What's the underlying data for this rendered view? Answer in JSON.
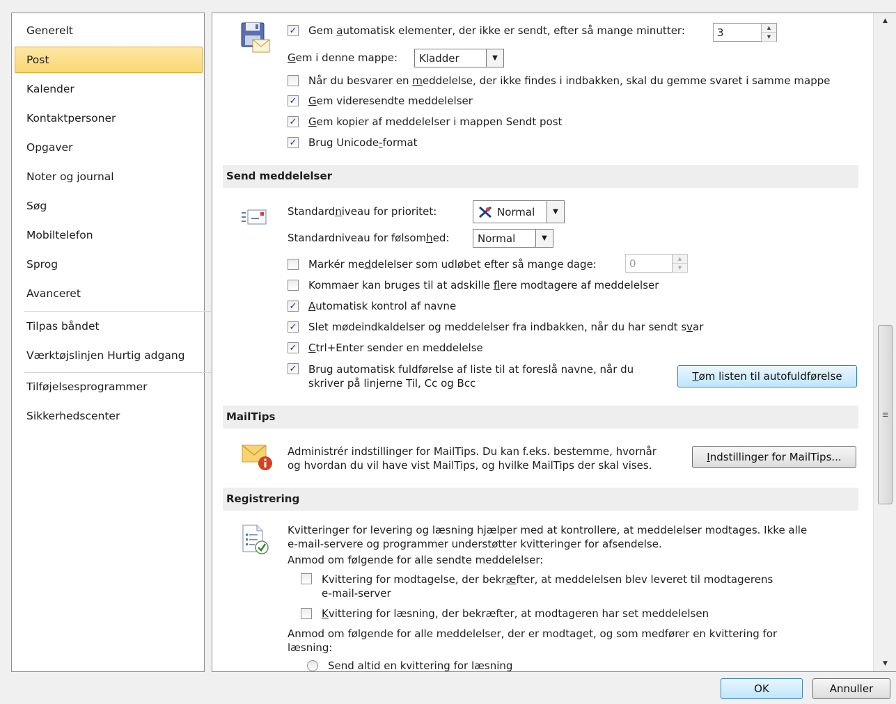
{
  "sidebar": {
    "items": [
      {
        "label": "Generelt"
      },
      {
        "label": "Post"
      },
      {
        "label": "Kalender"
      },
      {
        "label": "Kontaktpersoner"
      },
      {
        "label": "Opgaver"
      },
      {
        "label": "Noter og journal"
      },
      {
        "label": "Søg"
      },
      {
        "label": "Mobiltelefon"
      },
      {
        "label": "Sprog"
      },
      {
        "label": "Avanceret"
      },
      {
        "label": "Tilpas båndet"
      },
      {
        "label": "Værktøjslinjen Hurtig adgang"
      },
      {
        "label": "Tilføjelsesprogrammer"
      },
      {
        "label": "Sikkerhedscenter"
      }
    ],
    "selected": "Post"
  },
  "save": {
    "autosave": {
      "pre": "Gem ",
      "ul": "a",
      "post": "utomatisk elementer, der ikke er sendt, efter så mange minutter:",
      "checked": true
    },
    "minutes_value": "3",
    "folder_label": {
      "pre": "",
      "ul": "G",
      "post": "em i denne mappe:"
    },
    "folder_value": "Kladder",
    "reply_same_folder": {
      "pre": "Når du besvarer en ",
      "ul": "m",
      "post": "eddelelse, der ikke findes i indbakken, skal du gemme svaret i samme mappe",
      "checked": false
    },
    "save_forwarded": {
      "pre": "",
      "ul": "G",
      "post": "em videresendte meddelelser",
      "checked": true
    },
    "save_copies": {
      "pre": "",
      "ul": "G",
      "post": "em kopier af meddelelser i mappen Sendt post",
      "checked": true
    },
    "unicode": {
      "pre": "Brug Unicode",
      "ul": "-",
      "post": "format",
      "checked": true
    }
  },
  "send": {
    "header": "Send meddelelser",
    "priority_label": {
      "pre": "Standard",
      "ul": "n",
      "post": "iveau for prioritet:"
    },
    "priority_value": "Normal",
    "sensitivity_label": {
      "pre": "Standardniveau for følsom",
      "ul": "h",
      "post": "ed:"
    },
    "sensitivity_value": "Normal",
    "expire": {
      "pre": "Markér me",
      "ul": "d",
      "post": "delelser som udløbet efter så mange dage:",
      "checked": false
    },
    "expire_days": "0",
    "commas": {
      "pre": "Kommaer kan bruges til at adskille ",
      "ul": "f",
      "post": "lere modtagere af meddelelser",
      "checked": false
    },
    "auto_check_names": {
      "pre": "",
      "ul": "A",
      "post": "utomatisk kontrol af navne",
      "checked": true
    },
    "delete_meeting": {
      "pre": "Slet mødeindkaldelser og meddelelser fra indbakken, når du har sendt s",
      "ul": "v",
      "post": "ar",
      "checked": true
    },
    "ctrl_enter": {
      "pre": "",
      "ul": "C",
      "post": "trl+Enter sender en meddelelse",
      "checked": true
    },
    "autocomplete": {
      "line1": "Brug automatisk fuldførelse af liste til at foreslå navne, når du",
      "line2_pre": "skriver på lin",
      "line2_ul": "j",
      "line2_post": "erne Til, Cc og Bcc",
      "checked": true
    },
    "empty_autocomplete": {
      "pre": "",
      "ul": "T",
      "post": "øm listen til autofuldførelse"
    }
  },
  "mailtips": {
    "header": "MailTips",
    "desc_line1": "Administrér indstillinger for MailTips. Du kan f.eks. bestemme, hvornår",
    "desc_line2": "og hvordan du vil have vist MailTips, og hvilke MailTips der skal vises.",
    "button": {
      "pre": "",
      "ul": "I",
      "post": "ndstillinger for MailTips..."
    }
  },
  "tracking": {
    "header": "Registrering",
    "desc_line1": "Kvitteringer for levering og læsning hjælper med at kontrollere, at meddelelser modtages. Ikke alle",
    "desc_line2": "e-mail-servere og programmer understøtter kvitteringer for afsendelse.",
    "request_label": "Anmod om følgende for alle sendte meddelelser:",
    "delivery": {
      "pre": "Kvittering for modtagelse, der bekr",
      "ul": "æ",
      "post": "fter, at meddelelsen blev leveret til modtagerens",
      "line2": "e-mail-server",
      "checked": false
    },
    "read": {
      "pre": "",
      "ul": "K",
      "post": "vittering for læsning, der bekræfter, at modtageren har set meddelelsen",
      "checked": false
    },
    "received_line1": "Anmod om følgende for alle meddelelser, der er modtaget, og som medfører en kvittering for",
    "received_line2": "læsning:",
    "always_send": "Send altid en kvittering for læsning"
  },
  "footer": {
    "ok": "OK",
    "cancel": "Annuller"
  },
  "colors": {
    "selected_bg": "#fcd774",
    "primary_button": "#bee6fd",
    "section_header_bg": "#eeeeee"
  }
}
